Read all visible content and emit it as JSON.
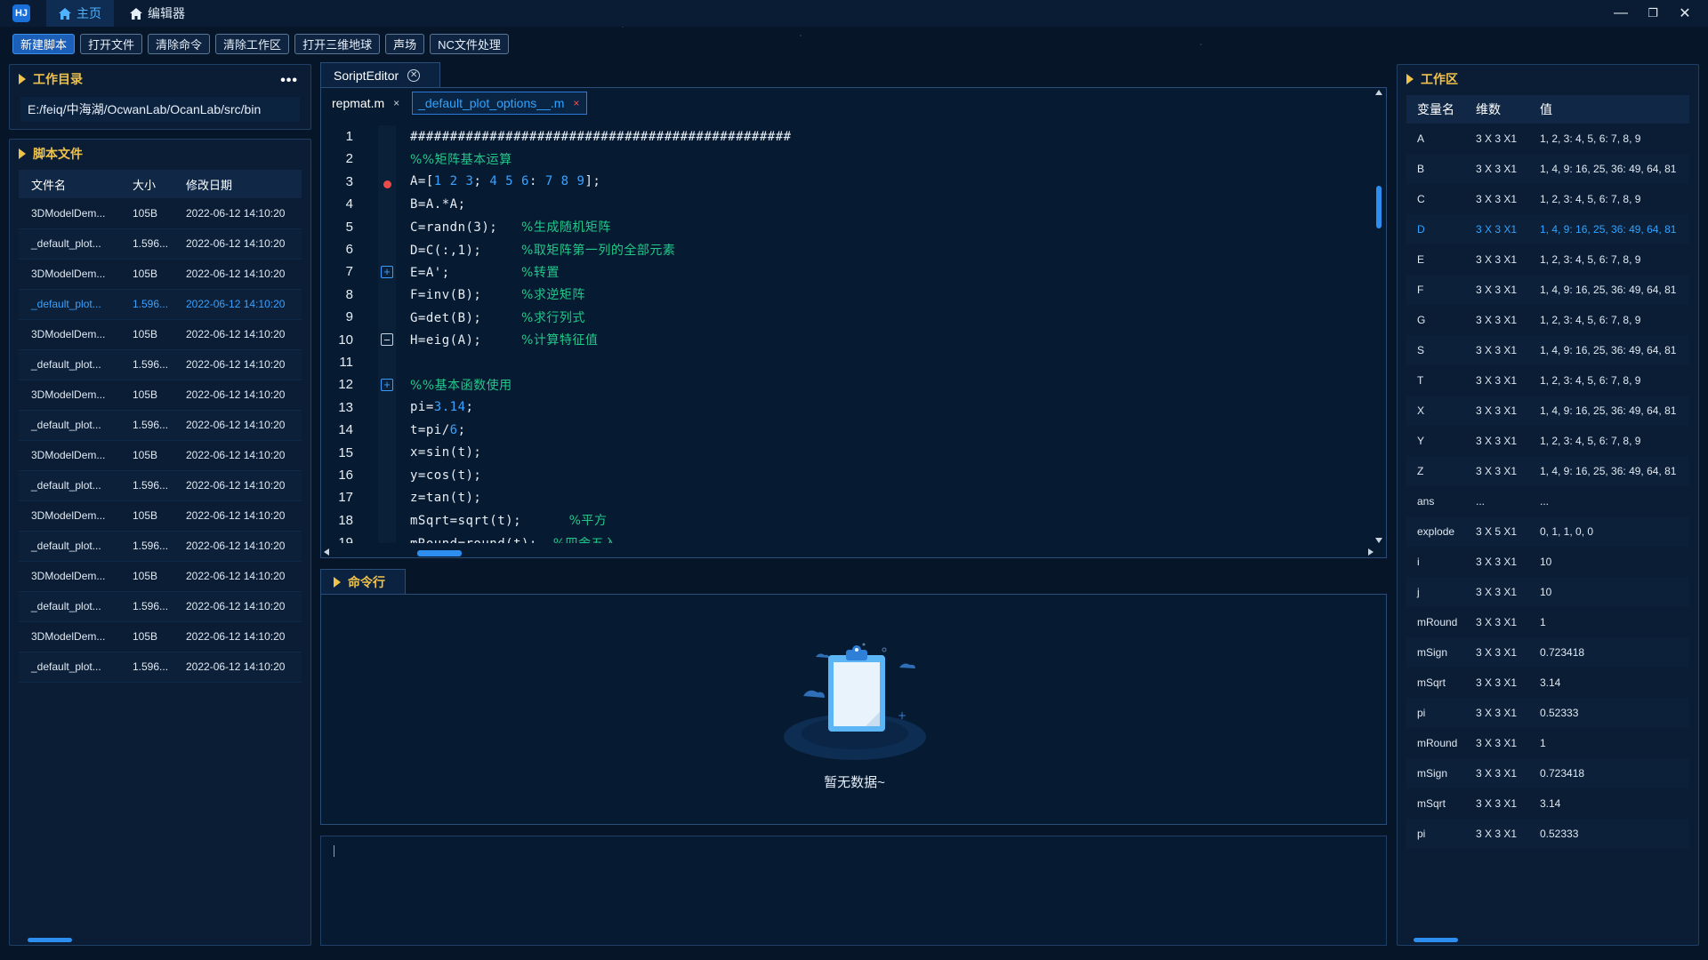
{
  "titlebar": {
    "logo": "HJ",
    "tabs": [
      {
        "label": "主页",
        "icon": "home-icon"
      },
      {
        "label": "编辑器",
        "icon": "home-icon"
      }
    ],
    "controls": {
      "minimize": "—",
      "restore": "❐",
      "close": "✕"
    }
  },
  "toolbar": {
    "buttons": [
      "新建脚本",
      "打开文件",
      "清除命令",
      "清除工作区",
      "打开三维地球",
      "声场",
      "NC文件处理"
    ]
  },
  "workdir": {
    "title": "工作目录",
    "more": "•••",
    "path": "E:/feiq/中海湖/OcwanLab/OcanLab/src/bin"
  },
  "scripts": {
    "title": "脚本文件",
    "headers": [
      "文件名",
      "大小",
      "修改日期"
    ],
    "rows": [
      [
        "3DModelDem...",
        "105B",
        "2022-06-12 14:10:20"
      ],
      [
        "_default_plot...",
        "1.596...",
        "2022-06-12 14:10:20"
      ],
      [
        "3DModelDem...",
        "105B",
        "2022-06-12 14:10:20"
      ],
      [
        "_default_plot...",
        "1.596...",
        "2022-06-12 14:10:20"
      ],
      [
        "3DModelDem...",
        "105B",
        "2022-06-12 14:10:20"
      ],
      [
        "_default_plot...",
        "1.596...",
        "2022-06-12 14:10:20"
      ],
      [
        "3DModelDem...",
        "105B",
        "2022-06-12 14:10:20"
      ],
      [
        "_default_plot...",
        "1.596...",
        "2022-06-12 14:10:20"
      ],
      [
        "3DModelDem...",
        "105B",
        "2022-06-12 14:10:20"
      ],
      [
        "_default_plot...",
        "1.596...",
        "2022-06-12 14:10:20"
      ],
      [
        "3DModelDem...",
        "105B",
        "2022-06-12 14:10:20"
      ],
      [
        "_default_plot...",
        "1.596...",
        "2022-06-12 14:10:20"
      ],
      [
        "3DModelDem...",
        "105B",
        "2022-06-12 14:10:20"
      ],
      [
        "_default_plot...",
        "1.596...",
        "2022-06-12 14:10:20"
      ],
      [
        "3DModelDem...",
        "105B",
        "2022-06-12 14:10:20"
      ],
      [
        "_default_plot...",
        "1.596...",
        "2022-06-12 14:10:20"
      ]
    ],
    "selected_index": 3
  },
  "editor": {
    "window_tab": "SoriptEditor",
    "file_tabs": [
      {
        "label": "repmat.m",
        "close": "×"
      },
      {
        "label": "_default_plot_options__.m",
        "close": "×"
      }
    ],
    "lines": [
      {
        "n": "1",
        "segs": [
          [
            "t",
            "################################################"
          ]
        ]
      },
      {
        "n": "2",
        "segs": [
          [
            "c",
            "%%矩阵基本运算"
          ]
        ]
      },
      {
        "n": "3",
        "segs": [
          [
            "t",
            "A=["
          ],
          [
            "n",
            "1 2 3"
          ],
          [
            "t",
            "; "
          ],
          [
            "n",
            "4 5 6"
          ],
          [
            "t",
            ": "
          ],
          [
            "n",
            "7 8 9"
          ],
          [
            "t",
            "];"
          ]
        ]
      },
      {
        "n": "4",
        "segs": [
          [
            "t",
            "B=A.*A;"
          ]
        ]
      },
      {
        "n": "5",
        "segs": [
          [
            "t",
            "C=randn(3);   "
          ],
          [
            "c",
            "%生成随机矩阵"
          ]
        ]
      },
      {
        "n": "6",
        "segs": [
          [
            "t",
            "D=C(:,1);     "
          ],
          [
            "c",
            "%取矩阵第一列的全部元素"
          ]
        ]
      },
      {
        "n": "7",
        "segs": [
          [
            "t",
            "E=A';         "
          ],
          [
            "c",
            "%转置"
          ]
        ]
      },
      {
        "n": "8",
        "segs": [
          [
            "t",
            "F=inv(B);     "
          ],
          [
            "c",
            "%求逆矩阵"
          ]
        ]
      },
      {
        "n": "9",
        "segs": [
          [
            "t",
            "G=det(B);     "
          ],
          [
            "c",
            "%求行列式"
          ]
        ]
      },
      {
        "n": "10",
        "segs": [
          [
            "t",
            "H=eig(A);     "
          ],
          [
            "c",
            "%计算特征值"
          ]
        ]
      },
      {
        "n": "11",
        "segs": []
      },
      {
        "n": "12",
        "segs": [
          [
            "c",
            "%%基本函数使用"
          ]
        ]
      },
      {
        "n": "13",
        "segs": [
          [
            "t",
            "pi="
          ],
          [
            "n",
            "3.14"
          ],
          [
            "t",
            ";"
          ]
        ]
      },
      {
        "n": "14",
        "segs": [
          [
            "t",
            "t=pi/"
          ],
          [
            "n",
            "6"
          ],
          [
            "t",
            ";"
          ]
        ]
      },
      {
        "n": "15",
        "segs": [
          [
            "t",
            "x=sin(t);"
          ]
        ]
      },
      {
        "n": "16",
        "segs": [
          [
            "t",
            "y=cos(t);"
          ]
        ]
      },
      {
        "n": "17",
        "segs": [
          [
            "t",
            "z=tan(t);"
          ]
        ]
      },
      {
        "n": "18",
        "segs": [
          [
            "t",
            "mSqrt=sqrt(t);      "
          ],
          [
            "c",
            "%平方"
          ]
        ]
      },
      {
        "n": "19",
        "segs": [
          [
            "t",
            "mRound=round(t);  "
          ],
          [
            "c",
            "%四舍五入"
          ]
        ]
      }
    ],
    "breakpoint_line": 3,
    "folds": [
      {
        "line": 7,
        "sym": "+"
      },
      {
        "line": 10,
        "sym": "−"
      },
      {
        "line": 12,
        "sym": "+"
      }
    ]
  },
  "command": {
    "title": "命令行",
    "empty_text": "暂无数据~"
  },
  "workspace": {
    "title": "工作区",
    "headers": [
      "变量名",
      "维数",
      "值"
    ],
    "rows": [
      [
        "A",
        "3 X 3 X1",
        "1, 2, 3: 4, 5, 6: 7, 8, 9"
      ],
      [
        "B",
        "3 X 3 X1",
        "1, 4, 9: 16, 25, 36: 49, 64, 81"
      ],
      [
        "C",
        "3 X 3 X1",
        "1, 2, 3: 4, 5, 6: 7, 8, 9"
      ],
      [
        "D",
        "3 X 3 X1",
        "1, 4, 9: 16, 25, 36: 49, 64, 81"
      ],
      [
        "E",
        "3 X 3 X1",
        "1, 2, 3: 4, 5, 6: 7, 8, 9"
      ],
      [
        "F",
        "3 X 3 X1",
        "1, 4, 9: 16, 25, 36: 49, 64, 81"
      ],
      [
        "G",
        "3 X 3 X1",
        "1, 2, 3: 4, 5, 6: 7, 8, 9"
      ],
      [
        "S",
        "3 X 3 X1",
        "1, 4, 9: 16, 25, 36: 49, 64, 81"
      ],
      [
        "T",
        "3 X 3 X1",
        "1, 2, 3: 4, 5, 6: 7, 8, 9"
      ],
      [
        "X",
        "3 X 3 X1",
        "1, 4, 9: 16, 25, 36: 49, 64, 81"
      ],
      [
        "Y",
        "3 X 3 X1",
        "1, 2, 3: 4, 5, 6: 7, 8, 9"
      ],
      [
        "Z",
        "3 X 3 X1",
        "1, 4, 9: 16, 25, 36: 49, 64, 81"
      ],
      [
        "ans",
        "...",
        "..."
      ],
      [
        "explode",
        "3 X 5 X1",
        "0, 1, 1, 0, 0"
      ],
      [
        "i",
        "3 X 3 X1",
        "10"
      ],
      [
        "j",
        "3 X 3 X1",
        "10"
      ],
      [
        "mRound",
        "3 X 3 X1",
        "1"
      ],
      [
        "mSign",
        "3 X 3 X1",
        "0.723418"
      ],
      [
        "mSqrt",
        "3 X 3 X1",
        "3.14"
      ],
      [
        "pi",
        "3 X 3 X1",
        "0.52333"
      ],
      [
        "mRound",
        "3 X 3 X1",
        "1"
      ],
      [
        "mSign",
        "3 X 3 X1",
        "0.723418"
      ],
      [
        "mSqrt",
        "3 X 3 X1",
        "3.14"
      ],
      [
        "pi",
        "3 X 3 X1",
        "0.52333"
      ]
    ],
    "selected_index": 3
  },
  "colors": {
    "accent": "#2fa3ff",
    "panel_title": "#f0c24a",
    "comment": "#22c78a",
    "breakpoint": "#e94b4b"
  }
}
